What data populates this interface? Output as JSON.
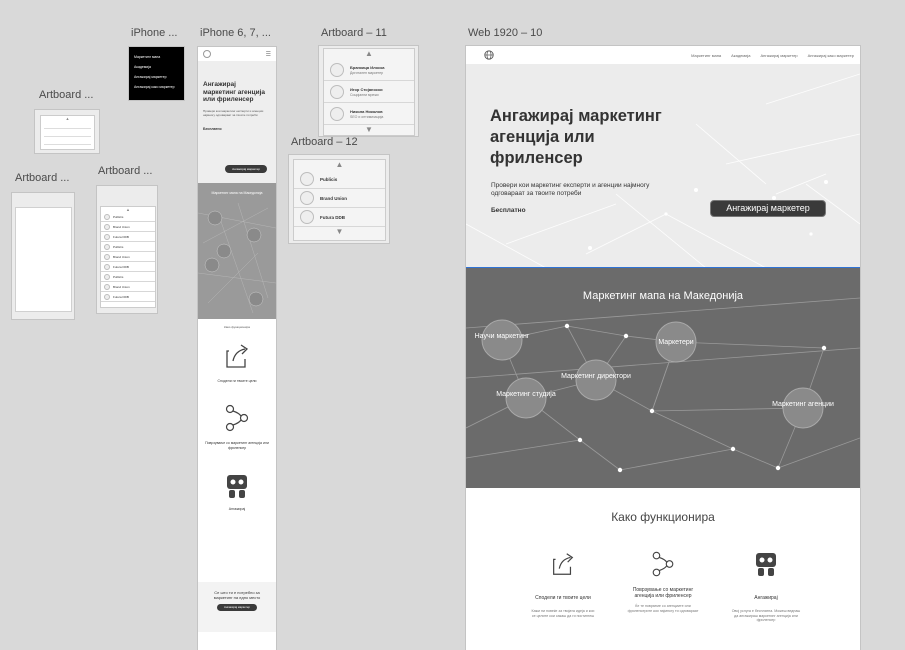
{
  "artboard_labels": {
    "iphone_short": "iPhone ...",
    "iphone_long": "iPhone 6, 7, ...",
    "ab11": "Artboard – 11",
    "ab12": "Artboard – 12",
    "web": "Web 1920 – 10",
    "ab_a": "Artboard ...",
    "ab_b": "Artboard ...",
    "ab_c": "Artboard ..."
  },
  "black_menu": [
    "Маркетинг мапа",
    "Академија",
    "Ангажирај маркетер",
    "Ангажирај како маркетер"
  ],
  "ab11": {
    "rows": [
      {
        "name": "Бранкица Илоска",
        "sub": "Дигитален маркетер"
      },
      {
        "name": "Игор Стојаноски",
        "sub": "Социјални мрежи"
      },
      {
        "name": "Никола Николов",
        "sub": "SEO и оптимизација"
      }
    ]
  },
  "ab12": {
    "rows": [
      "Publicis",
      "Brand Union",
      "Futura DDB"
    ]
  },
  "small_list": [
    "Publicis",
    "Brand Union",
    "Futura DDB",
    "Publicis",
    "Brand Union",
    "Futura DDB",
    "Publicis",
    "Brand Union",
    "Futura DDB"
  ],
  "web": {
    "nav": [
      "Маркетинг мапа",
      "Академија",
      "Ангажирај маркетер",
      "Ангажирај како маркетер"
    ],
    "hero_title": "Ангажирај маркетинг агенција или фрилeнсер",
    "hero_sub": "Провери кои маркетинг експерти и агенции најмногу одговараат за твоите потреби",
    "free": "Бесплатно",
    "cta": "Ангажирај маркетер",
    "map_title": "Маркетинг мапа на Македонија",
    "nodes": [
      "Научи маркетинг",
      "Маркетери",
      "Маркетинг директори",
      "Маркетинг студија",
      "Маркетинг агенции"
    ],
    "how_title": "Како функционира",
    "steps": [
      {
        "title": "Сподели ги твоите цели",
        "text": "Кажи ни повеќе за твојата идеја и кои се целите кои сакаш да ги постигнеш"
      },
      {
        "title": "Поврзување со маркетинг агенција или фрилeнсер",
        "text": "Ќе те поврземе со агенциите или фрилeнсерите кои најмногу ти одговараат"
      },
      {
        "title": "Ангажирај",
        "text": "Овој услуга е бесплатна. Можеш веднаш да ангажираш маркетинг агенција или фрилeнсер"
      }
    ]
  },
  "mobile": {
    "hero_title": "Ангажирај маркетинг агенција или фрилeнсер",
    "hero_sub": "Провери кои маркетинг експерти и агенции најмногу одговараат за твоите потреби",
    "free": "Бесплатно",
    "cta": "Ангажирај маркетер",
    "map_title": "Маркетинг мапа на Македонија",
    "how": "Како функционира",
    "step1": "Сподели ги твоите цели",
    "step2": "Поврзување со маркетинг агенција или фрилeнсер",
    "step3": "Ангажирај",
    "bottom": "Се што ти е потребно за маркетинг на едно место",
    "bottom_cta": "Ангажирај маркетер"
  },
  "colors": {
    "canvas": "#d9d9d9",
    "map_bg": "#6b6b6b",
    "hero_bg": "#ececec",
    "selection": "#2f73d6",
    "button": "#3a3a3a"
  }
}
